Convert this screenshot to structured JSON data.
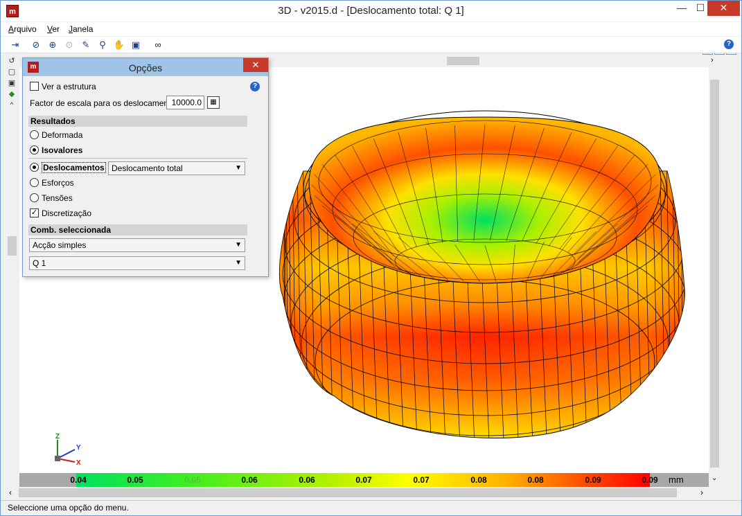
{
  "window": {
    "title": "3D - v2015.d - [Deslocamento total: Q 1]",
    "app_icon_text": "m",
    "controls": {
      "minimize": "—",
      "maximize": "☐",
      "close": "✕"
    }
  },
  "menu": {
    "items": [
      {
        "label": "Arquivo",
        "underline": "A",
        "rest": "rquivo"
      },
      {
        "label": "Ver",
        "underline": "V",
        "rest": "er"
      },
      {
        "label": "Janela",
        "underline": "J",
        "rest": "anela"
      }
    ]
  },
  "toolbar": {
    "icons": [
      "exit-icon",
      "zoom-window-icon",
      "zoom-all-icon",
      "zoom-previous-icon",
      "pen-icon",
      "zoom-in-icon",
      "pan-hand-icon",
      "window-icon",
      "binoculars-icon"
    ]
  },
  "options": {
    "title": "Opções",
    "ver_estrutura": "Ver a estrutura",
    "factor_label": "Factor de escala para os deslocamentos",
    "factor_value": "10000.0",
    "resultados_header": "Resultados",
    "deformada": "Deformada",
    "isovalores": "Isovalores",
    "deslocamentos": "Deslocamentos",
    "deslocamento_select": "Deslocamento total",
    "esforcos": "Esforços",
    "tensoes": "Tensões",
    "discretizacao": "Discretização",
    "comb_header": "Comb. seleccionada",
    "accao_select": "Acção simples",
    "q_select": "Q 1"
  },
  "axes": {
    "z": "Z",
    "y": "Y",
    "x": "X"
  },
  "legend": {
    "labels": [
      "0.04",
      "0.05",
      "0.05",
      "0.06",
      "0.06",
      "0.07",
      "0.07",
      "0.08",
      "0.08",
      "0.09",
      "0.09"
    ],
    "unit": "mm"
  },
  "status": {
    "text": "Seleccione uma opção do menu."
  }
}
